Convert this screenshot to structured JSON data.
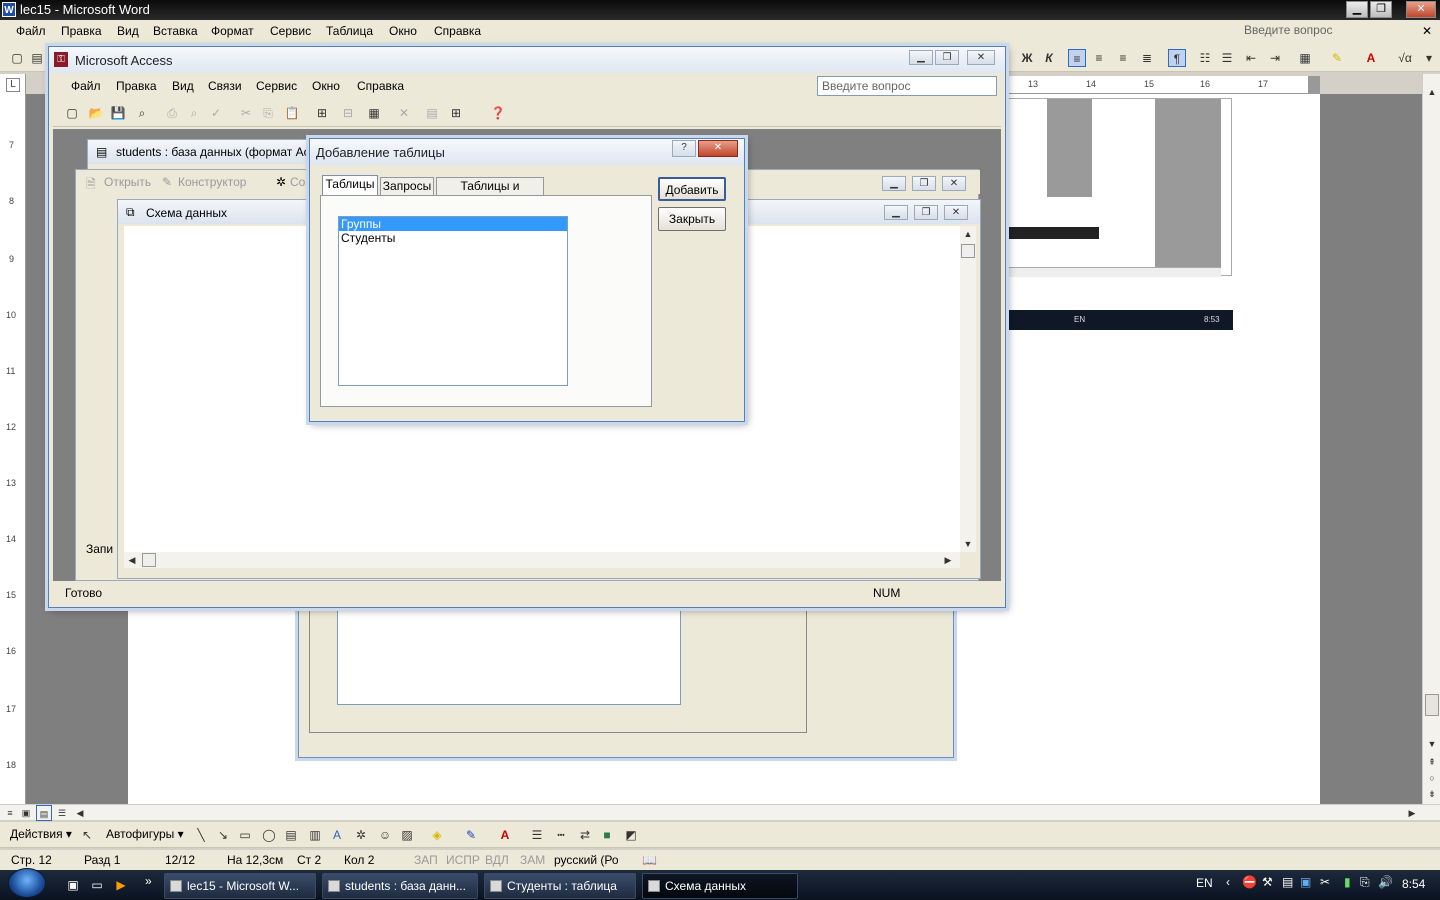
{
  "word": {
    "title": "lec15 - Microsoft Word",
    "icon": "W",
    "menu": [
      "Файл",
      "Правка",
      "Вид",
      "Вставка",
      "Формат",
      "Сервис",
      "Таблица",
      "Окно",
      "Справка"
    ],
    "ask_placeholder": "Введите вопрос",
    "ruler_marks": [
      "13",
      "14",
      "15",
      "16",
      "17"
    ],
    "ruler_v_marks": [
      "7",
      "8",
      "9",
      "10",
      "11",
      "12",
      "13",
      "14",
      "15",
      "16",
      "17",
      "18"
    ],
    "draw_actions": "Действия ▾",
    "autoshapes": "Автофигуры ▾",
    "status": {
      "page": "Стр. 12",
      "section": "Разд 1",
      "pages": "12/12",
      "at": "На 12,3см",
      "line": "Ст 2",
      "col": "Кол 2",
      "rec": "ЗАП",
      "trk": "ИСПР",
      "ext": "ВДЛ",
      "ovr": "ЗАМ",
      "lang": "русский (Ро"
    }
  },
  "access": {
    "title": "Microsoft Access",
    "menu": [
      "Файл",
      "Правка",
      "Вид",
      "Связи",
      "Сервис",
      "Окно",
      "Справка"
    ],
    "ask_placeholder": "Введите вопрос",
    "status_ready": "Готово",
    "status_num": "NUM",
    "db_window": {
      "title": "students : база данных (формат Acc",
      "open": "Открыть",
      "design": "Конструктор",
      "create": "Соз",
      "side_label": "Запи"
    },
    "schema_window": {
      "title": "Схема данных"
    }
  },
  "dialog": {
    "title": "Добавление таблицы",
    "help": "?",
    "close": "✕",
    "tabs": [
      "Таблицы",
      "Запросы",
      "Таблицы и запросы"
    ],
    "items": [
      "Группы",
      "Студенты"
    ],
    "add_button": "Добавить",
    "close_button": "Закрыть"
  },
  "taskbar": {
    "tasks": [
      "lec15 - Microsoft W...",
      "students : база данн...",
      "Студенты : таблица",
      "Схема данных"
    ],
    "lang": "EN",
    "time": "8:54",
    "chevron": "»"
  },
  "bg_screenshot": {
    "lang": "EN",
    "time": "8:53"
  }
}
